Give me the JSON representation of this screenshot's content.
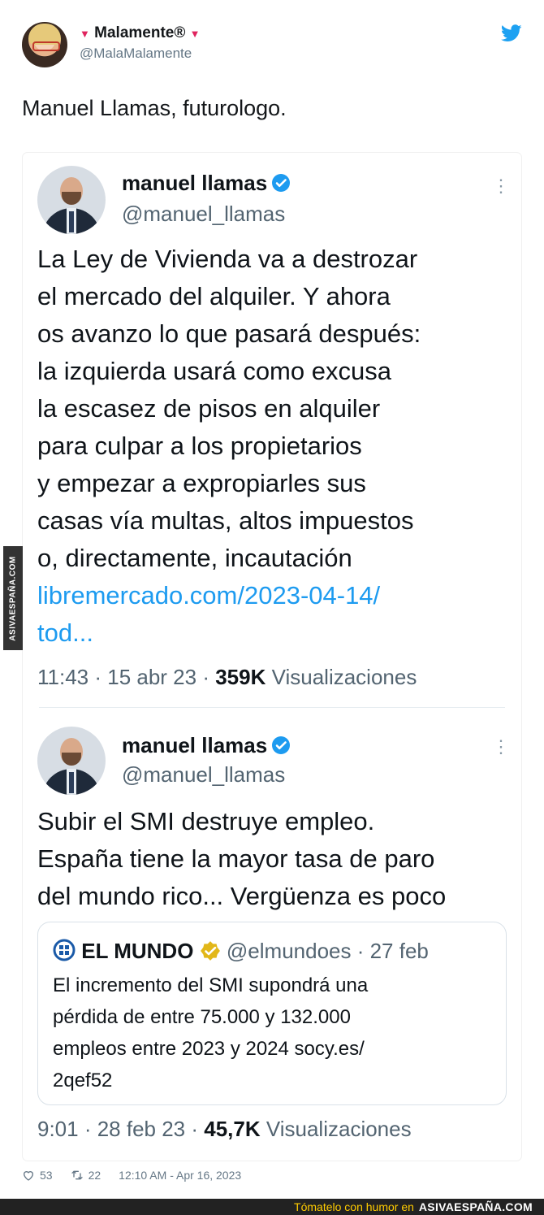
{
  "outer_tweet": {
    "display_name": "Malamente®",
    "handle": "@MalaMalamente",
    "text": "Manuel Llamas, futurologo.",
    "likes": "53",
    "retweets": "22",
    "timestamp": "12:10 AM - Apr 16, 2023"
  },
  "embedded_tweets": [
    {
      "name": "manuel llamas",
      "handle": "@manuel_llamas",
      "body_lines": [
        "La Ley de Vivienda va a destrozar",
        "el mercado del alquiler. Y ahora",
        "os avanzo lo que pasará después:",
        "la izquierda usará como excusa",
        "la escasez de pisos en alquiler",
        "para culpar a los propietarios",
        "y empezar a expropiarles sus",
        "casas vía multas, altos impuestos",
        "o, directamente, incautación"
      ],
      "link_lines": [
        "libremercado.com/2023-04-14/",
        "tod..."
      ],
      "time": "11:43 · 15 abr 23 · ",
      "views": "359K",
      "views_label": " Visualizaciones"
    },
    {
      "name": "manuel llamas",
      "handle": "@manuel_llamas",
      "body_lines": [
        "Subir el SMI destruye empleo.",
        "España tiene la mayor tasa de paro",
        "del mundo rico... Vergüenza es poco"
      ],
      "quote": {
        "source": "EL MUNDO",
        "meta": " @elmundoes · 27 feb",
        "lines": [
          "El incremento del SMI  supondrá una",
          "pérdida de entre 75.000 y 132.000",
          "empleos entre 2023 y 2024 socy.es/",
          "2qef52"
        ]
      },
      "time": "9:01 · 28 feb 23 · ",
      "views": "45,7K",
      "views_label": " Visualizaciones"
    }
  ],
  "watermark": {
    "side": "ASIVAESPAÑA.COM",
    "banner_tagline": "Tómatelo con humor en",
    "banner_brand": "ASIVAESPAÑA.COM"
  },
  "colors": {
    "twitter_blue": "#1da1f2",
    "link_blue": "#1d9bf0",
    "verified_blue": "#1d9bf0",
    "gold_check": "#e2b719",
    "heart_pink": "#e0245e",
    "banner_yellow": "#ffcc00"
  },
  "icons": [
    "heart-icon",
    "twitter-bird-icon",
    "verified-icon",
    "more-icon",
    "el-mundo-logo-icon",
    "gold-verified-icon",
    "like-icon",
    "retweet-icon"
  ]
}
